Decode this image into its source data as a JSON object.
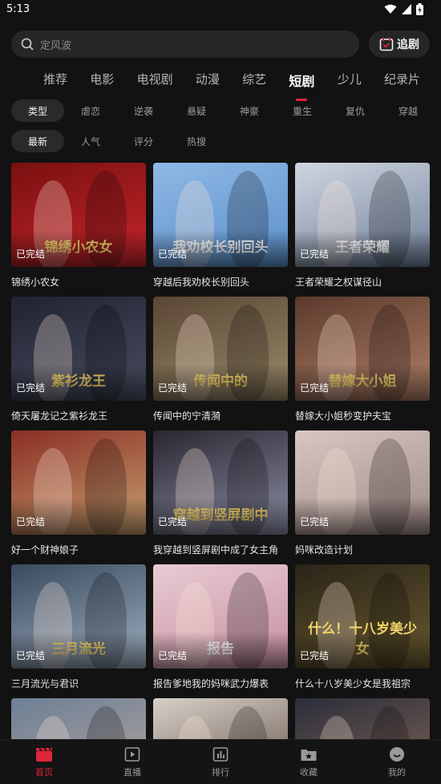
{
  "status": {
    "time": "5:13"
  },
  "search": {
    "placeholder": "定风波"
  },
  "follow_button": {
    "label": "追剧"
  },
  "channels": [
    {
      "label": "推荐"
    },
    {
      "label": "电影"
    },
    {
      "label": "电视剧"
    },
    {
      "label": "动漫"
    },
    {
      "label": "综艺"
    },
    {
      "label": "短剧"
    },
    {
      "label": "少儿"
    },
    {
      "label": "纪录片"
    }
  ],
  "filters_type": [
    {
      "label": "类型"
    },
    {
      "label": "虐恋"
    },
    {
      "label": "逆袭"
    },
    {
      "label": "悬疑"
    },
    {
      "label": "神豪"
    },
    {
      "label": "重生"
    },
    {
      "label": "复仇"
    },
    {
      "label": "穿越"
    }
  ],
  "filters_sort": [
    {
      "label": "最新"
    },
    {
      "label": "人气"
    },
    {
      "label": "评分"
    },
    {
      "label": "热搜"
    }
  ],
  "badge_text": "已完结",
  "cards": [
    {
      "title": "锦绣小农女",
      "art": "锦绣小农女",
      "colors": [
        "#7a1010",
        "#c6262b"
      ]
    },
    {
      "title": "穿越后我劝校长别回头",
      "art": "我劝校长别回头",
      "colors": [
        "#8fb9e6",
        "#5b8fc9"
      ]
    },
    {
      "title": "王者荣耀之权谋径山",
      "art": "王者荣耀",
      "colors": [
        "#cfd6e0",
        "#6f7f9a"
      ]
    },
    {
      "title": "倚天屠龙记之紫衫龙王",
      "art": "紫衫龙王",
      "colors": [
        "#1f2230",
        "#4a4f62"
      ]
    },
    {
      "title": "传闻中的宁清漪",
      "art": "传闻中的",
      "colors": [
        "#5a4634",
        "#9b8b6a"
      ]
    },
    {
      "title": "替嫁大小姐秒变护夫宝",
      "art": "替嫁大小姐",
      "colors": [
        "#5b3a2c",
        "#b08068"
      ]
    },
    {
      "title": "好一个财神娘子",
      "art": "",
      "colors": [
        "#8a2e24",
        "#c7a070"
      ]
    },
    {
      "title": "我穿越到竖屏剧中成了女主角",
      "art": "穿越到竖屏剧中",
      "colors": [
        "#2a2630",
        "#8d8fa6"
      ]
    },
    {
      "title": "妈咪改造计划",
      "art": "",
      "colors": [
        "#d9c6c2",
        "#9e8a86"
      ]
    },
    {
      "title": "三月流光与君识",
      "art": "三月流光",
      "colors": [
        "#3a4a5e",
        "#a0b0c2"
      ]
    },
    {
      "title": "报告爹地我的妈咪武力爆表",
      "art": "报告",
      "colors": [
        "#e8cbd3",
        "#c68f9f"
      ]
    },
    {
      "title": "什么十八岁美少女是我祖宗",
      "art": "什么！十八岁美少女",
      "colors": [
        "#2a2418",
        "#6a5a30"
      ]
    },
    {
      "title": "",
      "art": "",
      "colors": [
        "#6d7f95",
        "#b8a8a0"
      ]
    },
    {
      "title": "",
      "art": "",
      "colors": [
        "#d8d0c8",
        "#5a4a40"
      ]
    },
    {
      "title": "",
      "art": "",
      "colors": [
        "#2a2e3a",
        "#8a6a5a"
      ]
    }
  ],
  "bottom_nav": [
    {
      "label": "首页",
      "icon": "clapper-icon"
    },
    {
      "label": "直播",
      "icon": "play-icon"
    },
    {
      "label": "排行",
      "icon": "ranking-icon"
    },
    {
      "label": "收藏",
      "icon": "folder-star-icon"
    },
    {
      "label": "我的",
      "icon": "smile-icon"
    }
  ],
  "accent_color": "#e0243a"
}
